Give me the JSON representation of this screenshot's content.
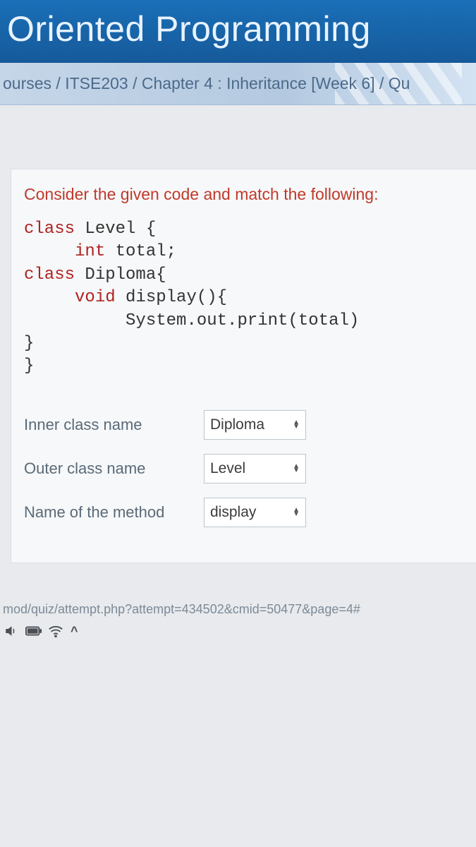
{
  "header": {
    "title": "Oriented Programming"
  },
  "breadcrumb": {
    "parts": [
      "ourses",
      " / ",
      "ITSE203",
      " / ",
      "Chapter 4 : Inheritance [Week 6]",
      " / ",
      "Qu"
    ]
  },
  "question": {
    "prompt": "Consider the given code and match the following:",
    "code": {
      "l1_kw": "class",
      "l1_rest": " Level {",
      "l2_kw": "int",
      "l2_rest": " total;",
      "l3_kw": "class",
      "l3_rest": " Diploma{",
      "l4_kw": "void",
      "l4_rest": " display(){",
      "l5": "          System.out.print(total)",
      "l6": "}",
      "l7": "}"
    },
    "matches": [
      {
        "label": "Inner class name",
        "value": "Diploma"
      },
      {
        "label": "Outer class name",
        "value": "Level"
      },
      {
        "label": "Name of the method",
        "value": "display"
      }
    ]
  },
  "footer": {
    "url": "mod/quiz/attempt.php?attempt=434502&cmid=50477&page=4#"
  },
  "taskbar": {
    "caret": "^"
  }
}
